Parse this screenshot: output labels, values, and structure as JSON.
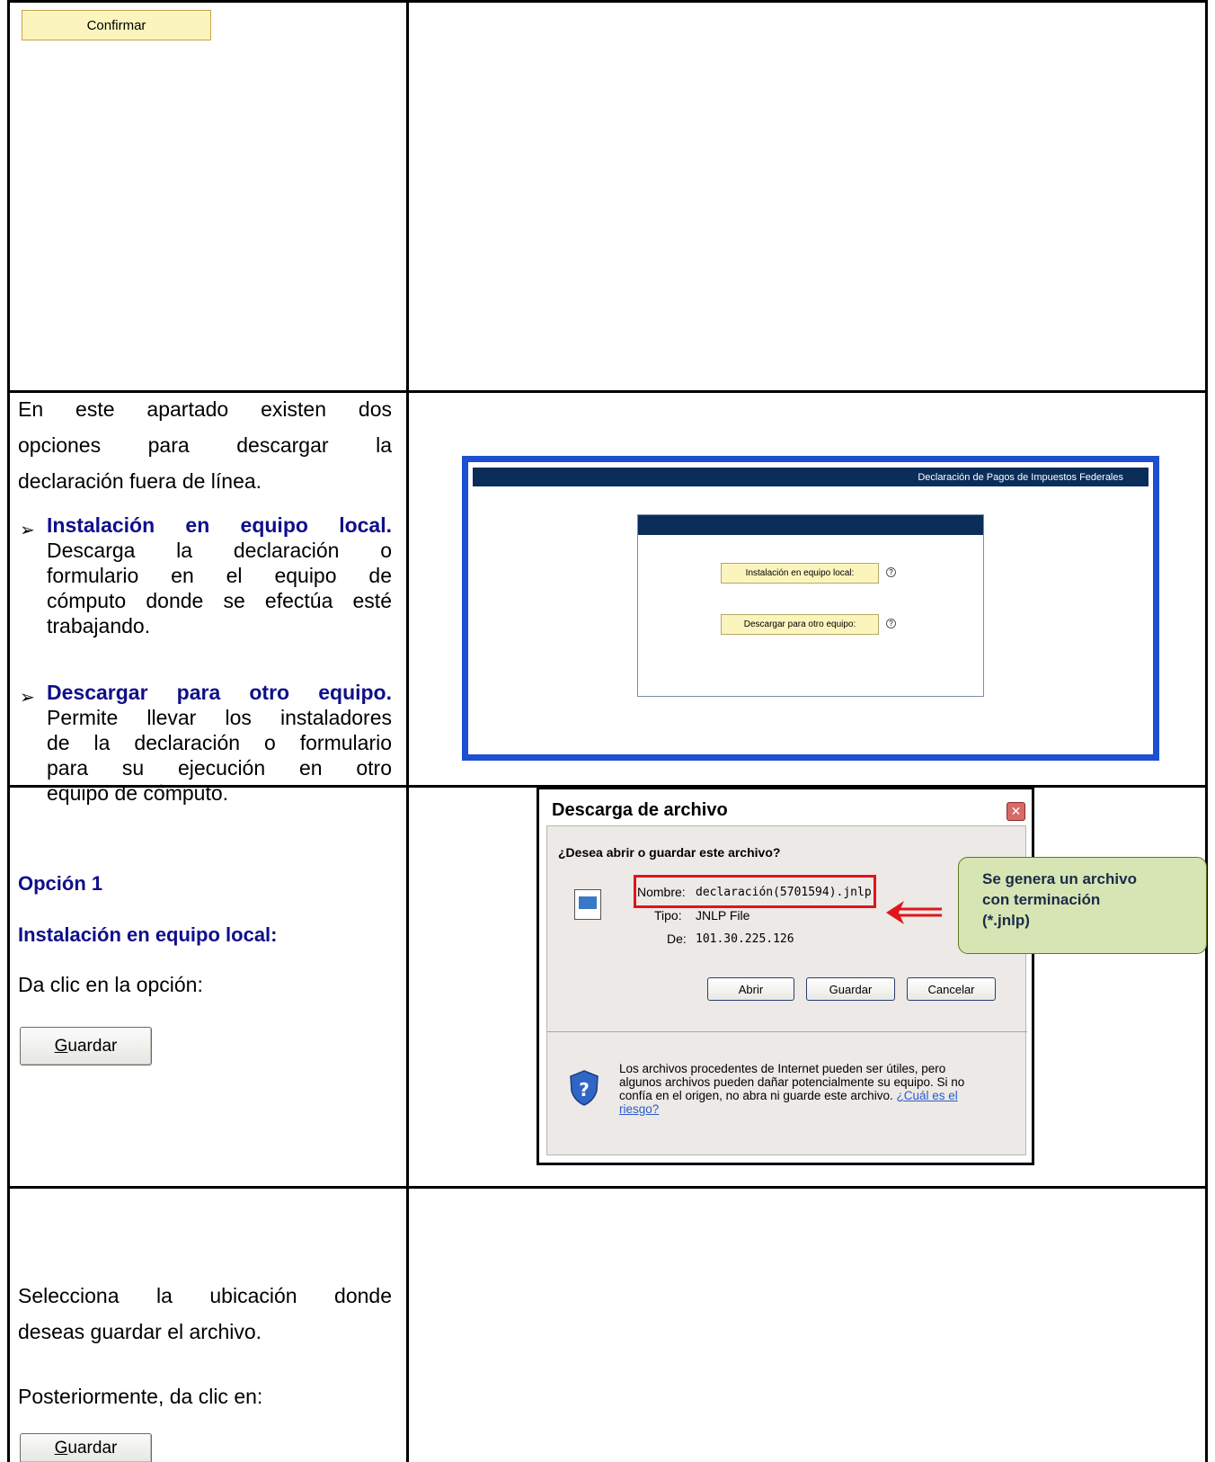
{
  "row1": {
    "confirm_button": "Confirmar"
  },
  "row2": {
    "intro": "En este apartado existen dos opciones para descargar la declaración fuera de línea.",
    "intro_lines": [
      "En este apartado existen dos",
      "opciones para descargar la",
      "declaración fuera de línea."
    ],
    "bullet1_title": "Instalación en equipo local.",
    "bullet1_lines": [
      "Descarga la declaración o",
      "formulario en el equipo de",
      "cómputo donde se efectúa esté",
      "trabajando."
    ],
    "bullet2_title": "Descargar para otro equipo.",
    "bullet2_lines": [
      "Permite llevar los instaladores",
      "de la declaración o formulario",
      "para su ejecución en otro",
      "equipo de cómputo."
    ],
    "screen": {
      "header": "Declaración de Pagos de Impuestos Federales",
      "btn_local": "Instalación en equipo local:",
      "btn_other": "Descargar para otro equipo:",
      "help": "?"
    }
  },
  "row3": {
    "option_title": "Opción 1",
    "option_subtitle": "Instalación en equipo local:",
    "instruction": "Da clic en la opción:",
    "save_button_prefix": "G",
    "save_button_rest": "uardar",
    "dialog": {
      "title": "Descarga de archivo",
      "close": "✕",
      "question": "¿Desea abrir o guardar este archivo?",
      "name_label": "Nombre:",
      "name_value": "declaración(5701594).jnlp",
      "type_label": "Tipo:",
      "type_value": "JNLP File",
      "from_label": "De:",
      "from_value": "101.30.225.126",
      "btn_open": "Abrir",
      "btn_save": "Guardar",
      "btn_cancel": "Cancelar",
      "warning_lines": [
        "Los archivos procedentes de Internet pueden ser útiles, pero",
        "algunos archivos pueden dañar potencialmente su equipo. Si no",
        "confía en el origen, no abra ni guarde este archivo."
      ],
      "risk_link_a": "¿Cuál es el",
      "risk_link_b": "riesgo?"
    },
    "callout_lines": [
      "Se genera un archivo",
      "con terminación",
      "(*.jnlp)"
    ]
  },
  "row4": {
    "select_lines": [
      "Selecciona la ubicación donde",
      "deseas guardar el archivo."
    ],
    "then": "Posteriormente, da clic en:",
    "save_button_prefix": "G",
    "save_button_rest": "uardar"
  },
  "colors": {
    "frame_blue": "#1c4fd1",
    "navy_text": "#0f0f8a",
    "header_navy": "#0b2d5a",
    "highlight_red": "#e0151b",
    "callout_green": "#d6e5b3"
  }
}
